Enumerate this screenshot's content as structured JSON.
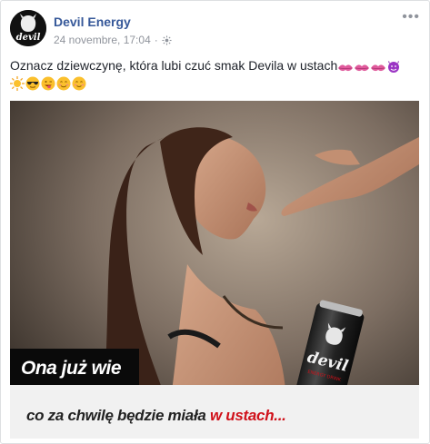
{
  "post": {
    "page_name": "Devil Energy",
    "timestamp": "24 novembre, 17:04",
    "separator": "·",
    "more_label": "•••",
    "caption": "Oznacz dziewczynę, która lubi czuć smak Devila w ustach",
    "caption_emojis_line1": [
      "kiss-mark",
      "kiss-mark",
      "kiss-mark",
      "smiling-devil"
    ],
    "caption_emojis_line2": [
      "sun",
      "sunglasses-face",
      "winking-tongue-face",
      "smiling-face",
      "blushing-face"
    ]
  },
  "avatar": {
    "logo_text": "devil"
  },
  "image": {
    "banner_dark_text": "Ona już wie",
    "banner_light_prefix": "co za chwilę będzie miała ",
    "banner_light_highlight": "w ustach...",
    "can_brand": "devil",
    "can_subtext": "ENERGY DRINK"
  },
  "colors": {
    "page_name": "#365899",
    "meta": "#90949c",
    "highlight_red": "#d0111a"
  }
}
